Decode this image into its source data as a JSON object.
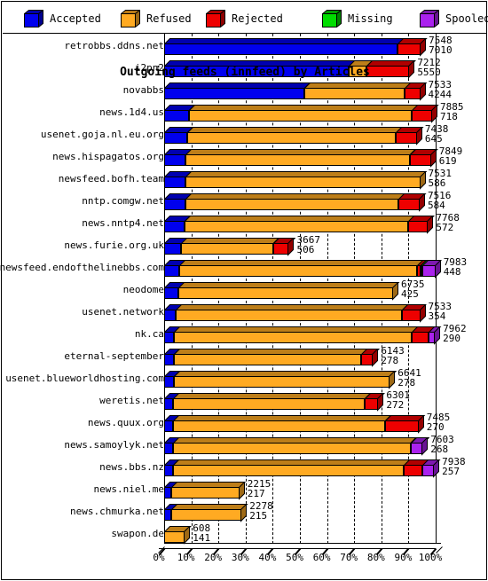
{
  "legend": {
    "items": [
      {
        "label": "Accepted",
        "color": "#0000ee",
        "icon": "cube-icon"
      },
      {
        "label": "Refused",
        "color": "#ffaa22",
        "icon": "cube-icon"
      },
      {
        "label": "Rejected",
        "color": "#ee0000",
        "icon": "cube-icon"
      },
      {
        "label": "Missing",
        "color": "#00dd00",
        "icon": "cube-icon"
      },
      {
        "label": "Spooled",
        "color": "#aa22ee",
        "icon": "cube-icon"
      }
    ]
  },
  "axis": {
    "title": "Outgoing feeds (innfeed) by Articles",
    "ticks": [
      "0%",
      "10%",
      "20%",
      "30%",
      "40%",
      "50%",
      "60%",
      "70%",
      "80%",
      "90%",
      "100%"
    ]
  },
  "chart_data": {
    "type": "bar",
    "orientation": "horizontal",
    "stacked": true,
    "title": "Outgoing feeds (innfeed) by Articles",
    "xlabel": "Outgoing feeds (innfeed) by Articles",
    "ylabel": "",
    "xlim": [
      0,
      100
    ],
    "xtick_labels": [
      "0%",
      "10%",
      "20%",
      "30%",
      "40%",
      "50%",
      "60%",
      "70%",
      "80%",
      "90%",
      "100%"
    ],
    "grid": true,
    "legend_position": "top",
    "series_names": [
      "Accepted",
      "Refused",
      "Rejected",
      "Missing",
      "Spooled"
    ],
    "categories": [
      "retrobbs.ddns.net",
      "i2pn2",
      "novabbs",
      "news.1d4.us",
      "usenet.goja.nl.eu.org",
      "news.hispagatos.org",
      "newsfeed.bofh.team",
      "nntp.comgw.net",
      "news.nntp4.net",
      "news.furie.org.uk",
      "newsfeed.endofthelinebbs.com",
      "neodome",
      "usenet.network",
      "nk.ca",
      "eternal-september",
      "usenet.blueworldhosting.com",
      "weretis.net",
      "news.quux.org",
      "news.samoylyk.net",
      "news.bbs.nz",
      "news.niel.me",
      "news.chmurka.net",
      "swapon.de"
    ],
    "rows": [
      {
        "name": "retrobbs.ddns.net",
        "total": 7548,
        "secondary": 7010,
        "total_frac": 94.5,
        "segments": [
          {
            "series": "Accepted",
            "pct": 86.0
          },
          {
            "series": "Rejected",
            "pct": 8.5
          }
        ]
      },
      {
        "name": "i2pn2",
        "total": 7212,
        "secondary": 5550,
        "total_frac": 90.3,
        "segments": [
          {
            "series": "Accepted",
            "pct": 68.0
          },
          {
            "series": "Refused",
            "pct": 6.5
          },
          {
            "series": "Rejected",
            "pct": 15.8
          }
        ]
      },
      {
        "name": "novabbs",
        "total": 7533,
        "secondary": 4244,
        "total_frac": 94.3,
        "segments": [
          {
            "series": "Accepted",
            "pct": 51.5
          },
          {
            "series": "Refused",
            "pct": 37.0
          },
          {
            "series": "Rejected",
            "pct": 5.8
          }
        ]
      },
      {
        "name": "news.1d4.us",
        "total": 7885,
        "secondary": 718,
        "total_frac": 98.7,
        "segments": [
          {
            "series": "Accepted",
            "pct": 9.0
          },
          {
            "series": "Refused",
            "pct": 82.2
          },
          {
            "series": "Rejected",
            "pct": 7.5
          }
        ]
      },
      {
        "name": "usenet.goja.nl.eu.org",
        "total": 7438,
        "secondary": 645,
        "total_frac": 93.1,
        "segments": [
          {
            "series": "Accepted",
            "pct": 8.4
          },
          {
            "series": "Refused",
            "pct": 76.9
          },
          {
            "series": "Rejected",
            "pct": 7.8
          }
        ]
      },
      {
        "name": "news.hispagatos.org",
        "total": 7849,
        "secondary": 619,
        "total_frac": 98.3,
        "segments": [
          {
            "series": "Accepted",
            "pct": 7.9
          },
          {
            "series": "Refused",
            "pct": 82.5
          },
          {
            "series": "Rejected",
            "pct": 7.9
          }
        ]
      },
      {
        "name": "newsfeed.bofh.team",
        "total": 7531,
        "secondary": 586,
        "total_frac": 94.3,
        "segments": [
          {
            "series": "Accepted",
            "pct": 7.8
          },
          {
            "series": "Refused",
            "pct": 86.5
          }
        ]
      },
      {
        "name": "nntp.comgw.net",
        "total": 7516,
        "secondary": 584,
        "total_frac": 94.1,
        "segments": [
          {
            "series": "Accepted",
            "pct": 7.8
          },
          {
            "series": "Refused",
            "pct": 78.5
          },
          {
            "series": "Rejected",
            "pct": 7.8
          }
        ]
      },
      {
        "name": "news.nntp4.net",
        "total": 7768,
        "secondary": 572,
        "total_frac": 97.2,
        "segments": [
          {
            "series": "Accepted",
            "pct": 7.4
          },
          {
            "series": "Refused",
            "pct": 82.5
          },
          {
            "series": "Rejected",
            "pct": 7.3
          }
        ]
      },
      {
        "name": "news.furie.org.uk",
        "total": 3667,
        "secondary": 506,
        "total_frac": 45.9,
        "segments": [
          {
            "series": "Accepted",
            "pct": 6.3
          },
          {
            "series": "Refused",
            "pct": 33.8
          },
          {
            "series": "Rejected",
            "pct": 5.8
          }
        ]
      },
      {
        "name": "newsfeed.endofthelinebbs.com",
        "total": 7983,
        "secondary": 448,
        "total_frac": 99.9,
        "segments": [
          {
            "series": "Accepted",
            "pct": 5.6
          },
          {
            "series": "Refused",
            "pct": 87.6
          },
          {
            "series": "Rejected",
            "pct": 1.2
          },
          {
            "series": "Missing",
            "pct": 0.8
          },
          {
            "series": "Spooled",
            "pct": 4.7
          }
        ]
      },
      {
        "name": "neodome",
        "total": 6735,
        "secondary": 425,
        "total_frac": 84.3,
        "segments": [
          {
            "series": "Accepted",
            "pct": 5.3
          },
          {
            "series": "Refused",
            "pct": 79.0
          }
        ]
      },
      {
        "name": "usenet.network",
        "total": 7533,
        "secondary": 354,
        "total_frac": 94.3,
        "segments": [
          {
            "series": "Accepted",
            "pct": 4.4
          },
          {
            "series": "Refused",
            "pct": 83.3
          },
          {
            "series": "Rejected",
            "pct": 6.6
          }
        ]
      },
      {
        "name": "nk.ca",
        "total": 7962,
        "secondary": 290,
        "total_frac": 99.7,
        "segments": [
          {
            "series": "Accepted",
            "pct": 3.6
          },
          {
            "series": "Refused",
            "pct": 87.6
          },
          {
            "series": "Rejected",
            "pct": 6.3
          },
          {
            "series": "Spooled",
            "pct": 2.2
          }
        ]
      },
      {
        "name": "eternal-september",
        "total": 6143,
        "secondary": 278,
        "total_frac": 76.9,
        "segments": [
          {
            "series": "Accepted",
            "pct": 3.5
          },
          {
            "series": "Refused",
            "pct": 69.0
          },
          {
            "series": "Rejected",
            "pct": 4.4
          }
        ]
      },
      {
        "name": "usenet.blueworldhosting.com",
        "total": 6641,
        "secondary": 278,
        "total_frac": 83.1,
        "segments": [
          {
            "series": "Accepted",
            "pct": 3.5
          },
          {
            "series": "Refused",
            "pct": 79.6
          }
        ]
      },
      {
        "name": "weretis.net",
        "total": 6301,
        "secondary": 272,
        "total_frac": 78.9,
        "segments": [
          {
            "series": "Accepted",
            "pct": 3.4
          },
          {
            "series": "Refused",
            "pct": 70.5
          },
          {
            "series": "Rejected",
            "pct": 5.0
          }
        ]
      },
      {
        "name": "news.quux.org",
        "total": 7485,
        "secondary": 270,
        "total_frac": 93.7,
        "segments": [
          {
            "series": "Accepted",
            "pct": 3.4
          },
          {
            "series": "Refused",
            "pct": 78.0
          },
          {
            "series": "Rejected",
            "pct": 12.3
          }
        ]
      },
      {
        "name": "news.samoylyk.net",
        "total": 7603,
        "secondary": 268,
        "total_frac": 95.2,
        "segments": [
          {
            "series": "Accepted",
            "pct": 3.4
          },
          {
            "series": "Refused",
            "pct": 87.3
          },
          {
            "series": "Spooled",
            "pct": 4.5
          }
        ]
      },
      {
        "name": "news.bbs.nz",
        "total": 7938,
        "secondary": 257,
        "total_frac": 99.4,
        "segments": [
          {
            "series": "Accepted",
            "pct": 3.2
          },
          {
            "series": "Refused",
            "pct": 85.0
          },
          {
            "series": "Rejected",
            "pct": 7.0
          },
          {
            "series": "Spooled",
            "pct": 4.2
          }
        ]
      },
      {
        "name": "news.niel.me",
        "total": 2215,
        "secondary": 217,
        "total_frac": 27.7,
        "segments": [
          {
            "series": "Accepted",
            "pct": 2.7
          },
          {
            "series": "Refused",
            "pct": 25.0
          }
        ]
      },
      {
        "name": "news.chmurka.net",
        "total": 2278,
        "secondary": 215,
        "total_frac": 28.5,
        "segments": [
          {
            "series": "Accepted",
            "pct": 2.7
          },
          {
            "series": "Refused",
            "pct": 25.8
          }
        ]
      },
      {
        "name": "swapon.de",
        "total": 608,
        "secondary": 141,
        "total_frac": 7.6,
        "segments": [
          {
            "series": "Refused",
            "pct": 7.6
          }
        ]
      }
    ]
  }
}
